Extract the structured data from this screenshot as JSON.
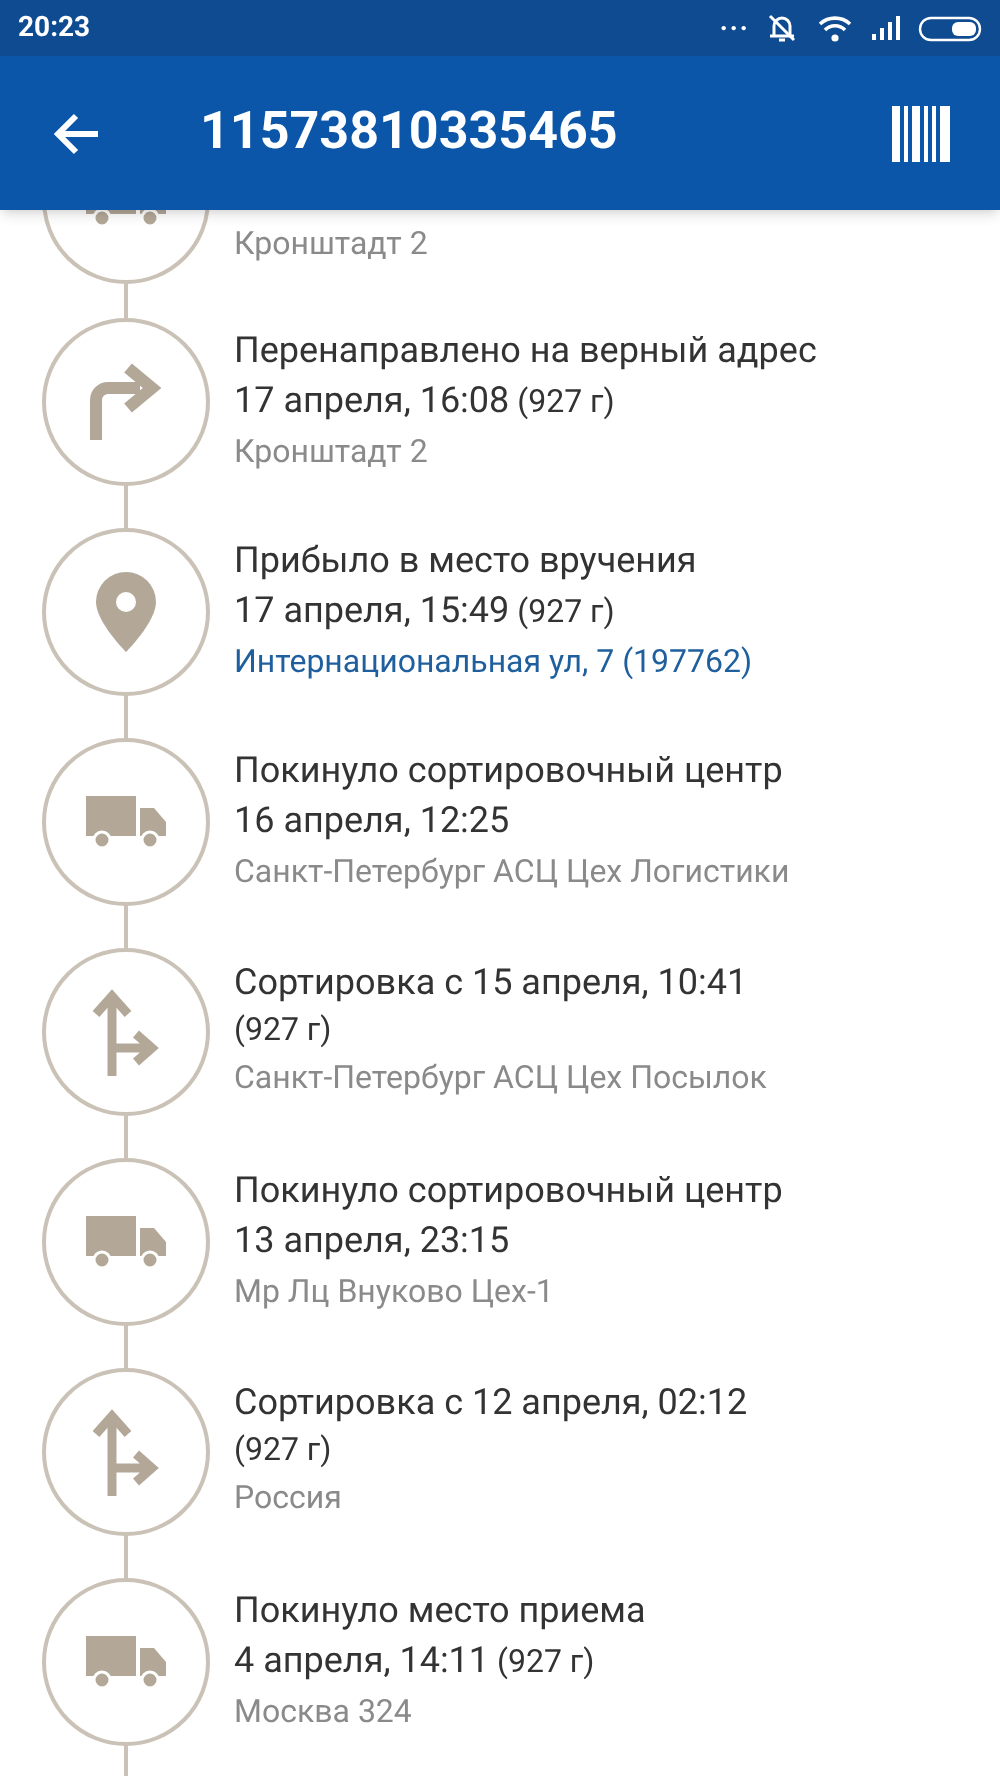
{
  "status_bar": {
    "time": "20:23",
    "more": "..."
  },
  "app_bar": {
    "title": "11573810335465"
  },
  "events": [
    {
      "kind": "truck",
      "location": "Кронштадт 2",
      "location_link": false
    },
    {
      "kind": "redirect",
      "title": "Перенаправлено на верный адрес",
      "date": "17 апреля, 16:08",
      "weight": "(927 г)",
      "location": "Кронштадт 2",
      "location_link": false
    },
    {
      "kind": "pin",
      "title": "Прибыло в место вручения",
      "date": "17 апреля, 15:49",
      "weight": "(927 г)",
      "location": "Интернациональная ул, 7 (197762)",
      "location_link": true
    },
    {
      "kind": "truck",
      "title": "Покинуло сортировочный центр",
      "date": "16 апреля, 12:25",
      "location": "Санкт-Петербург АСЦ Цех Логистики",
      "location_link": false
    },
    {
      "kind": "sort",
      "title": "Сортировка с 15 апреля, 10:41",
      "weight": "(927 г)",
      "location": "Санкт-Петербург АСЦ Цех Посылок",
      "location_link": false
    },
    {
      "kind": "truck",
      "title": "Покинуло сортировочный центр",
      "date": "13 апреля, 23:15",
      "location": "Мр Лц Внуково Цех-1",
      "location_link": false
    },
    {
      "kind": "sort",
      "title": "Сортировка с 12 апреля, 02:12",
      "weight": "(927 г)",
      "location": "Россия",
      "location_link": false
    },
    {
      "kind": "truck",
      "title": "Покинуло место приема",
      "date": "4 апреля, 14:11",
      "weight": "(927 г)",
      "location": "Москва 324",
      "location_link": false
    }
  ]
}
